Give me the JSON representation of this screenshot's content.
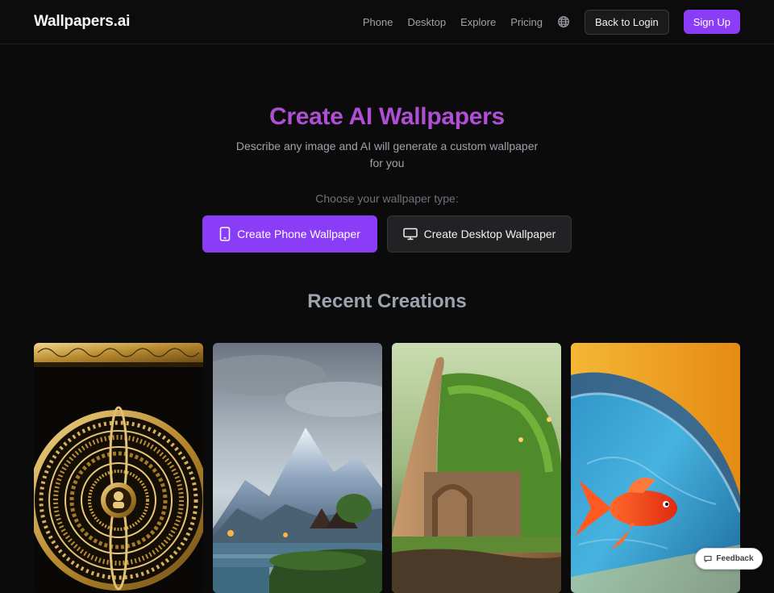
{
  "header": {
    "logo": "Wallpapers.ai",
    "nav": [
      "Phone",
      "Desktop",
      "Explore",
      "Pricing"
    ],
    "globe_icon": "globe-icon",
    "login_label": "Back to Login",
    "signup_label": "Sign Up"
  },
  "hero": {
    "title": "Create AI Wallpapers",
    "subtitle": "Describe any image and AI will generate a custom wallpaper for you",
    "choose_label": "Choose your wallpaper type:",
    "phone_button": "Create Phone Wallpaper",
    "desktop_button": "Create Desktop Wallpaper"
  },
  "recent": {
    "title": "Recent Creations"
  },
  "feedback": {
    "label": "Feedback"
  },
  "colors": {
    "accent": "#8b3cf7",
    "title": "#b04fd6",
    "background": "#0b0b0c"
  }
}
